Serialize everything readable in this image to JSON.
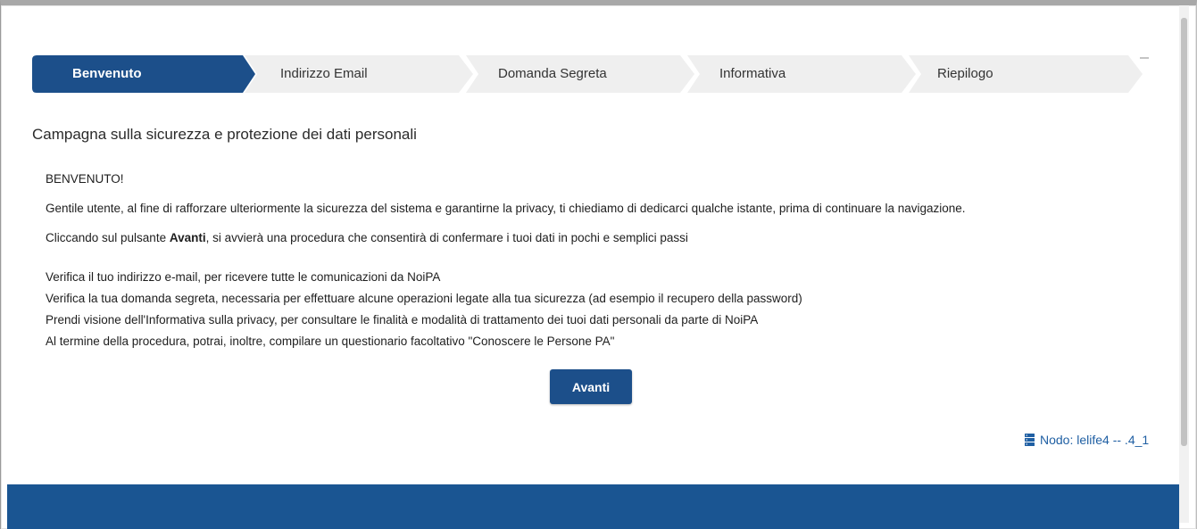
{
  "stepper": {
    "steps": [
      {
        "label": "Benvenuto",
        "active": true
      },
      {
        "label": "Indirizzo Email",
        "active": false
      },
      {
        "label": "Domanda Segreta",
        "active": false
      },
      {
        "label": "Informativa",
        "active": false
      },
      {
        "label": "Riepilogo",
        "active": false
      }
    ]
  },
  "page": {
    "title": "Campagna sulla sicurezza e protezione dei dati personali"
  },
  "content": {
    "greeting": "BENVENUTO!",
    "intro": "Gentile utente, al fine di rafforzare ulteriormente la sicurezza del sistema e garantirne la privacy, ti chiediamo di dedicarci qualche istante, prima di continuare la navigazione.",
    "instruction_prefix": "Cliccando sul pulsante ",
    "instruction_bold": "Avanti",
    "instruction_suffix": ", si avvierà una procedura che consentirà di confermare i tuoi dati in pochi e semplici passi",
    "items": [
      "Verifica il tuo indirizzo e-mail, per ricevere tutte le comunicazioni da NoiPA",
      "Verifica la tua domanda segreta, necessaria per effettuare alcune operazioni legate alla tua sicurezza (ad esempio il recupero della password)",
      "Prendi visione dell'Informativa sulla privacy, per consultare le finalità e modalità di trattamento dei tuoi dati personali da parte di NoiPA",
      "Al termine della procedura, potrai, inoltre, compilare un questionario facoltativo \"Conoscere le Persone PA\""
    ]
  },
  "actions": {
    "avanti_label": "Avanti"
  },
  "node": {
    "icon": "server-icon",
    "text": "Nodo: lelife4 -- .4_1"
  },
  "colors": {
    "primary": "#1c4f8a",
    "footer": "#1a5592",
    "inactive_step": "#efefef",
    "link": "#1f5fa3"
  }
}
